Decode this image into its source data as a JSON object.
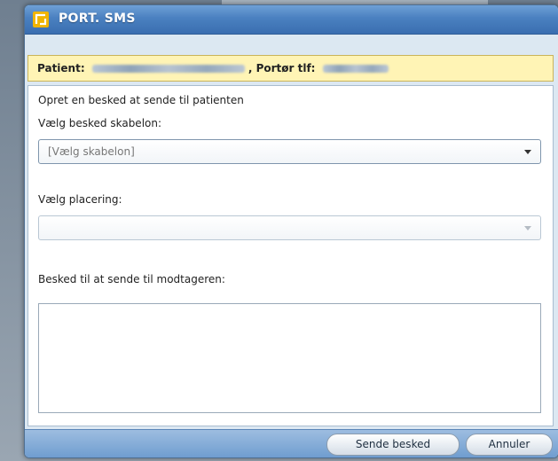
{
  "dialog": {
    "title": "PORT. SMS",
    "logo_icon": "app-logo-icon",
    "accent_color": "#3a6eb0"
  },
  "patient_bar": {
    "patient_label": "Patient:",
    "porter_label": ", Portør tlf:",
    "background_color": "#fff4b5"
  },
  "form": {
    "intro": "Opret en besked at sende til patienten",
    "template_label": "Vælg besked skabelon:",
    "template_value": "[Vælg skabelon]",
    "placement_label": "Vælg placering:",
    "placement_value": "",
    "message_label": "Besked til at sende til modtageren:",
    "message_value": ""
  },
  "footer": {
    "send_label": "Sende besked",
    "cancel_label": "Annuler"
  }
}
